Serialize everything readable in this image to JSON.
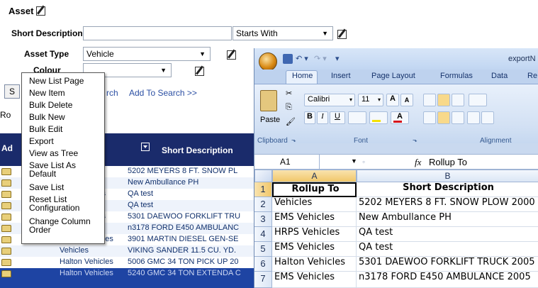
{
  "asset_form": {
    "title": "Asset",
    "short_desc_label": "Short Description",
    "match_mode": "Starts With",
    "asset_type_label": "Asset Type",
    "asset_type_value": "Vehicle",
    "colour_label": "Colour",
    "add_to_search": "Add To Search >>",
    "search_tail": "rch",
    "search_btn_fragment": "S",
    "rows_fragment": "Ro",
    "adv_fragment": "Ad"
  },
  "context_menu": {
    "items": [
      "New List Page",
      "New Item",
      "Bulk Delete",
      "Bulk New",
      "Bulk Edit",
      "Export",
      "View as Tree",
      "Save List As",
      "Default",
      "Save List",
      "Reset List",
      "Configuration",
      "Change Column",
      "Order"
    ]
  },
  "grid": {
    "short_desc_header": "Short Description",
    "rows": [
      {
        "rollup": "",
        "desc": "5202 MEYERS 8 FT. SNOW PL"
      },
      {
        "rollup": "les",
        "desc": "New Ambullance PH"
      },
      {
        "rollup": "icles",
        "desc": "QA test"
      },
      {
        "rollup": "es",
        "desc": "QA test"
      },
      {
        "rollup": "icles",
        "desc": "5301 DAEWOO FORKLIFT TRU"
      },
      {
        "rollup": "es",
        "desc": "n3178 FORD E450 AMBULANC"
      },
      {
        "rollup": "Halton Vehicles",
        "desc": "3901 MARTIN DIESEL GEN-SE"
      },
      {
        "rollup": "Vehicles",
        "desc": "VIKING SANDER 11.5 CU. YD."
      },
      {
        "rollup": "Halton Vehicles",
        "desc": "5006 GMC 34 TON PICK UP 20"
      },
      {
        "rollup": "Halton Vehicles",
        "desc": "5240 GMC 34 TON EXTENDA C"
      }
    ]
  },
  "excel": {
    "title_fragment": "exportN",
    "tabs": [
      "Home",
      "Insert",
      "Page Layout",
      "Formulas",
      "Data",
      "Re"
    ],
    "ribbon": {
      "paste": "Paste",
      "font_name": "Calibri",
      "font_size": "11",
      "bold": "B",
      "italic": "I",
      "underline": "U",
      "grow_font": "A",
      "shrink_font": "A",
      "font_color": "A",
      "groups": [
        "Clipboard",
        "Font",
        "Alignment"
      ]
    },
    "name_box": "A1",
    "fx": "fx",
    "formula": "Rollup To",
    "col_a": "A",
    "col_b": "B",
    "rows": [
      {
        "num": "1",
        "a": "Rollup To",
        "b": "Short Description"
      },
      {
        "num": "2",
        "a": "Vehicles",
        "b": "5202 MEYERS 8 FT. SNOW PLOW 2000"
      },
      {
        "num": "3",
        "a": "EMS Vehicles",
        "b": "New Ambullance PH"
      },
      {
        "num": "4",
        "a": "HRPS Vehicles",
        "b": "QA test"
      },
      {
        "num": "5",
        "a": "EMS Vehicles",
        "b": "QA test"
      },
      {
        "num": "6",
        "a": "Halton Vehicles",
        "b": "5301 DAEWOO FORKLIFT TRUCK 2005"
      },
      {
        "num": "7",
        "a": "EMS Vehicles",
        "b": "n3178 FORD E450 AMBULANCE 2005"
      }
    ]
  },
  "colors": {
    "grid_header": "#1a2b6b",
    "excel_chrome": "#c9d9ef",
    "link": "#2b4fa3"
  }
}
